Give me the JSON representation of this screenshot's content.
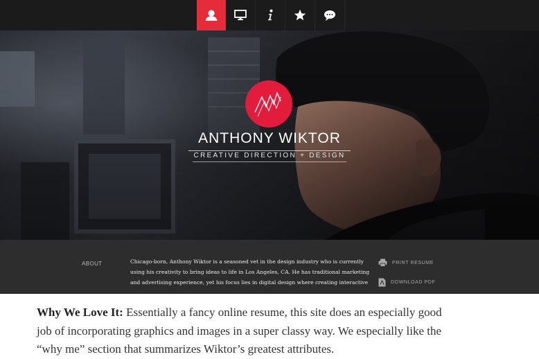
{
  "nav": {
    "items": [
      {
        "icon": "person-icon",
        "active": true
      },
      {
        "icon": "monitor-icon",
        "active": false
      },
      {
        "icon": "info-icon",
        "active": false
      },
      {
        "icon": "star-icon",
        "active": false
      },
      {
        "icon": "speech-bubble-icon",
        "active": false
      }
    ],
    "active_color": "#e62c3b"
  },
  "hero": {
    "logo_color": "#e31c3d",
    "name": "ANTHONY WIKTOR",
    "tagline": "CREATIVE DIRECTION + DESIGN"
  },
  "about": {
    "label": "ABOUT",
    "lines": [
      "Chicago-born, Anthony Wiktor is a seasoned vet in the design industry who is currently",
      "using his creativity to bring ideas to life in Los Angeles, CA. He has traditional marketing",
      "and advertising experience, yet his focus lies in digital design where creating interactive"
    ],
    "print_label": "PRINT RESUME",
    "download_label": "DOWNLOAD PDF"
  },
  "article": {
    "lead": "Why We Love It:",
    "line1": " Essentially a fancy online resume, this site does an especially good",
    "line2": "job of incorporating graphics and images in a super classy way. We especially like the",
    "line3": "“why me” section that summarizes Wiktor’s greatest attributes."
  }
}
